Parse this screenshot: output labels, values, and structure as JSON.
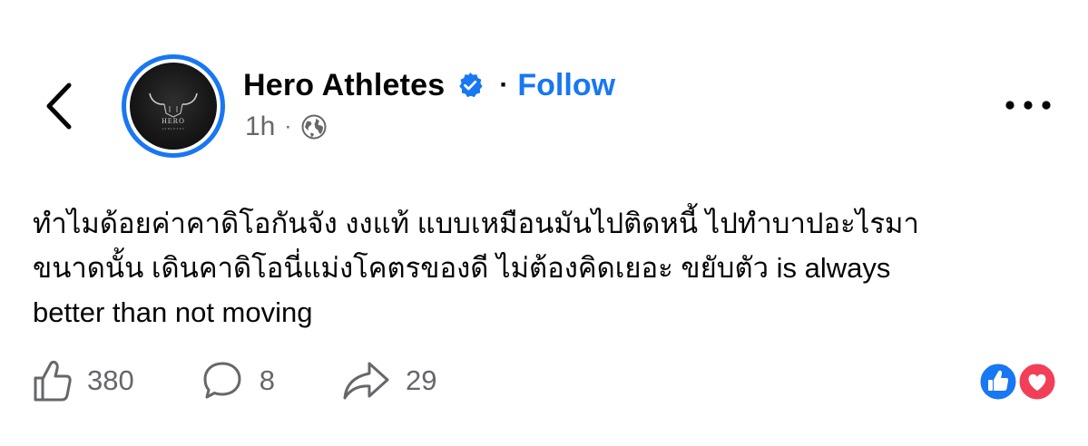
{
  "header": {
    "page_name": "Hero Athletes",
    "separator": "·",
    "follow_label": "Follow",
    "time": "1h",
    "meta_separator": "·",
    "privacy_icon": "globe-icon",
    "avatar_text": "HERO",
    "avatar_subtext": "ATHLETES"
  },
  "post": {
    "lines": [
      "ทำไมด้อยค่าคาดิโอกันจัง งงแท้ แบบเหมือนมันไปติดหนี้ ไปทำบาปอะไรมา",
      "ขนาดนั้น เดินคาดิโอนี่แม่งโคตรของดี ไม่ต้องคิดเยอะ ขยับตัว is always",
      "better than not moving"
    ]
  },
  "actions": {
    "likes": "380",
    "comments": "8",
    "shares": "29"
  },
  "reactions": [
    "like-reaction-icon",
    "love-reaction-icon"
  ],
  "colors": {
    "accent": "#1877f2",
    "love": "#f33e58",
    "secondary_text": "#65676b"
  }
}
